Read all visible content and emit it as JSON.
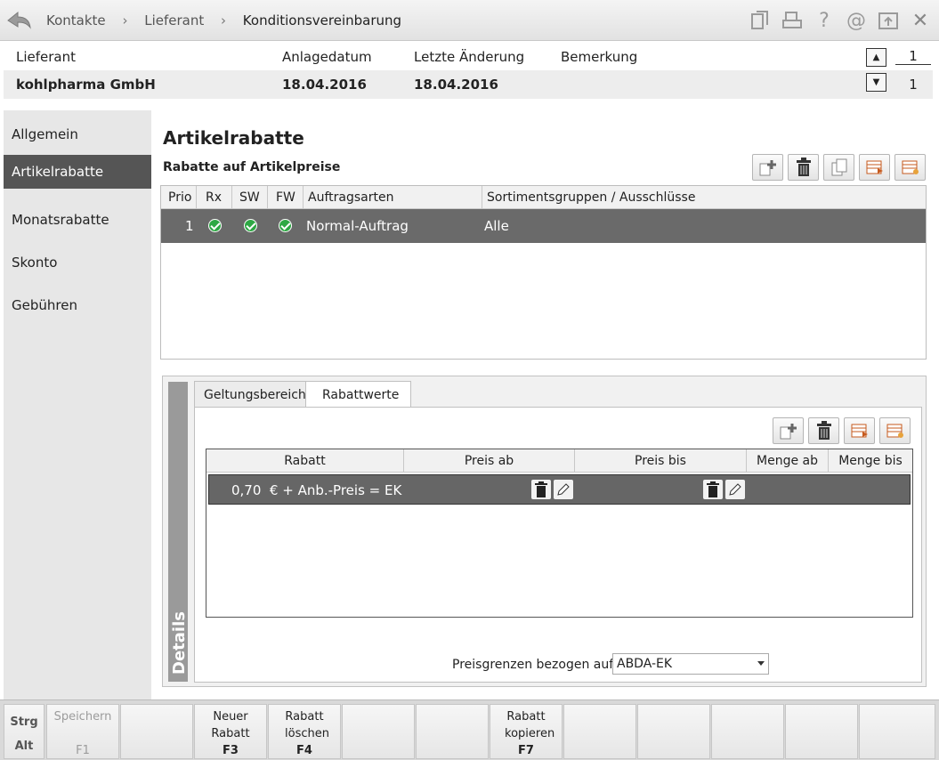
{
  "breadcrumb": [
    "Kontakte",
    "Lieferant",
    "Konditionsvereinbarung"
  ],
  "toolbar_icons": [
    "copy-icon",
    "print-icon",
    "help-icon",
    "email-icon",
    "window-icon",
    "close-icon"
  ],
  "header": {
    "labels": {
      "lieferant": "Lieferant",
      "anlagedatum": "Anlagedatum",
      "letzte_aenderung": "Letzte Änderung",
      "bemerkung": "Bemerkung"
    },
    "values": {
      "lieferant": "kohlpharma GmbH",
      "anlagedatum": "18.04.2016",
      "letzte_aenderung": "18.04.2016",
      "bemerkung": ""
    },
    "page_current": "1",
    "page_total": "1"
  },
  "sidebar": {
    "items": [
      {
        "label": "Allgemein",
        "active": false
      },
      {
        "label": "Artikelrabatte",
        "active": true
      },
      {
        "label": "Monatsrabatte",
        "active": false
      },
      {
        "label": "Skonto",
        "active": false
      },
      {
        "label": "Gebühren",
        "active": false
      }
    ]
  },
  "main": {
    "title": "Artikelrabatte",
    "subtitle": "Rabatte auf Artikelpreise",
    "table": {
      "columns": [
        "Prio",
        "Rx",
        "SW",
        "FW",
        "Auftragsarten",
        "Sortimentsgruppen / Ausschlüsse"
      ],
      "rows": [
        {
          "prio": "1",
          "rx": true,
          "sw": true,
          "fw": true,
          "auftragsarten": "Normal-Auftrag",
          "sortimentsgruppen": "Alle"
        }
      ]
    },
    "details": {
      "label": "Details",
      "tabs": [
        {
          "label": "Geltungsbereich",
          "active": false
        },
        {
          "label": "Rabattwerte",
          "active": true
        }
      ],
      "table": {
        "columns": [
          "Rabatt",
          "Preis ab",
          "Preis bis",
          "Menge ab",
          "Menge bis"
        ],
        "rows": [
          {
            "rabatt": "0,70  € + Anb.-Preis = EK"
          }
        ]
      },
      "preisgrenzen_label": "Preisgrenzen bezogen auf",
      "preisgrenzen_value": "ABDA-EK"
    }
  },
  "fkeys": {
    "strg": "Strg",
    "alt": "Alt",
    "keys": [
      {
        "label": "Speichern",
        "key": "F1",
        "enabled": false
      },
      {
        "label": "",
        "key": "",
        "enabled": false
      },
      {
        "label": "Neuer Rabatt",
        "key": "F3",
        "enabled": true
      },
      {
        "label": "Rabatt löschen",
        "key": "F4",
        "enabled": true
      },
      {
        "label": "",
        "key": "",
        "enabled": false
      },
      {
        "label": "",
        "key": "",
        "enabled": false
      },
      {
        "label": "Rabatt kopieren",
        "key": "F7",
        "enabled": true
      },
      {
        "label": "",
        "key": "",
        "enabled": false
      },
      {
        "label": "",
        "key": "",
        "enabled": false
      },
      {
        "label": "",
        "key": "",
        "enabled": false
      },
      {
        "label": "",
        "key": "",
        "enabled": false
      },
      {
        "label": "",
        "key": "",
        "enabled": false
      }
    ]
  }
}
